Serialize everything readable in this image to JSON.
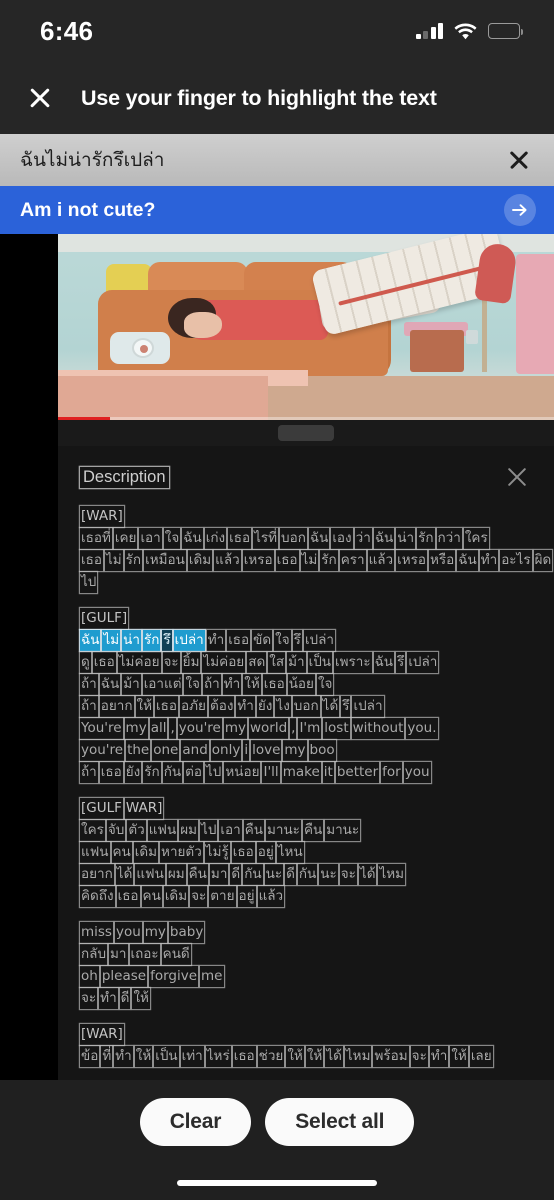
{
  "status_bar": {
    "time": "6:46",
    "signal_icon": "cellular-signal-icon",
    "wifi_icon": "wifi-icon",
    "battery_icon": "battery-low-icon"
  },
  "header": {
    "close_icon": "close-icon",
    "title": "Use your finger to highlight the text"
  },
  "translate": {
    "source_text": "ฉันไม่น่ารักรึเปล่า",
    "source_close_icon": "close-icon",
    "target_text": "Am i not cute?",
    "submit_icon": "arrow-right-icon"
  },
  "description": {
    "title": "Description",
    "close_icon": "close-icon"
  },
  "verses": [
    {
      "tag": [
        "[WAR]"
      ],
      "lines": [
        [
          "เธอที่",
          "เคย",
          "เอา",
          "ใจ",
          "ฉัน",
          "เก่ง",
          "เธอ",
          "ไรที่",
          "บอก",
          "ฉัน",
          "เอง",
          "ว่า",
          "ฉัน",
          "น่า",
          "รัก",
          "กว่า",
          "ใคร"
        ],
        [
          "เธอ",
          "ไม่",
          "รัก",
          "เหมือน",
          "เดิม",
          "แล้ว",
          "เหรอ",
          "เธอ",
          "ไม่",
          "รัก",
          "ครา",
          "แล้ว",
          "เหรอ",
          "หรือ",
          "ฉัน",
          "ทำ",
          "อะไร",
          "ผิด"
        ],
        [
          "ไป"
        ]
      ]
    },
    {
      "tag": [
        "[GULF]"
      ],
      "lines": [
        [
          "ฉัน",
          "ไม่",
          "น่า",
          "รัก",
          "รึ",
          "เปล่า",
          "ทำ",
          "เธอ",
          "ขัด",
          "ใจ",
          "รึ",
          "เปล่า"
        ],
        [
          "ดู",
          "เธอ",
          "ไม่ค่อย",
          "จะ",
          "ยิ้ม",
          "ไม่ค่อย",
          "สด",
          "ใส",
          "ม้า",
          "เป็น",
          "เพราะ",
          "ฉัน",
          "รึ",
          "เปล่า"
        ],
        [
          "ถ้า",
          "ฉัน",
          "ม้า",
          "เอาแต่",
          "ใจ",
          "ถ้า",
          "ทำ",
          "ให้",
          "เธอ",
          "น้อย",
          "ใจ"
        ],
        [
          "ถ้า",
          "อยาก",
          "ให้",
          "เธอ",
          "อภัย",
          "ต้อง",
          "ทำ",
          "ยัง",
          "ไง",
          "บอก",
          "ได้",
          "รึ",
          "เปล่า"
        ],
        [
          "You're",
          "my",
          "all",
          ",",
          "you're",
          "my",
          "world",
          ",",
          "I'm",
          "lost",
          "without",
          "you."
        ],
        [
          "you're",
          "the",
          "one",
          "and",
          "only",
          "i",
          "love",
          "my",
          "boo"
        ],
        [
          "ถ้า",
          "เธอ",
          "ยัง",
          "รัก",
          "กัน",
          "ต่อ",
          "ไป",
          "หน่อย",
          "I'll",
          "make",
          "it",
          "better",
          "for",
          "you"
        ]
      ],
      "highlight": {
        "line": 0,
        "words": [
          0,
          1,
          2,
          3,
          4,
          5
        ],
        "dark_words": [
          4
        ]
      }
    },
    {
      "tag": [
        "[GULF",
        "WAR]"
      ],
      "lines": [
        [
          "ใคร",
          "จับ",
          "ตัว",
          "แฟน",
          "ผม",
          "ไป",
          "เอา",
          "คืน",
          "มานะ",
          "คืน",
          "มานะ"
        ],
        [
          "แฟน",
          "คน",
          "เดิม",
          "หายตัว",
          "ไม่รู้",
          "เธอ",
          "อยู่",
          "ไหน"
        ],
        [
          "อยาก",
          "ได้",
          "แฟน",
          "ผม",
          "คืน",
          "มา",
          "ดี",
          "กัน",
          "นะ",
          "ดี",
          "กัน",
          "นะ",
          "จะ",
          "ได้",
          "ไหม"
        ],
        [
          "คิดถึง",
          "เธอ",
          "คน",
          "เดิม",
          "จะ",
          "ตาย",
          "อยู่",
          "แล้ว"
        ]
      ]
    },
    {
      "tag": [],
      "lines": [
        [
          "miss",
          "you",
          "my",
          "baby"
        ],
        [
          "กลับ",
          "มา",
          "เถอะ",
          "คนดี"
        ],
        [
          "oh",
          "please",
          "forgive",
          "me"
        ],
        [
          "จะ",
          "ทำ",
          "ดี",
          "ให้"
        ]
      ]
    },
    {
      "tag": [
        "[WAR]"
      ],
      "lines": [
        [
          "ข้อ",
          "ที่",
          "ทำ",
          "ให้",
          "เป็น",
          "เท่า",
          "ไหร่",
          "เธอ",
          "ช่วย",
          "ให้",
          "ให้",
          "ได้",
          "ไหม",
          "พร้อม",
          "จะ",
          "ทำ",
          "ให้",
          "เลย"
        ]
      ]
    }
  ],
  "actions": {
    "clear_label": "Clear",
    "select_all_label": "Select all"
  },
  "colors": {
    "accent_blue": "#2b62d9",
    "highlight_cyan": "#1f9ccf",
    "progress_red": "#e02020",
    "battery_yellow": "#f5c518"
  }
}
